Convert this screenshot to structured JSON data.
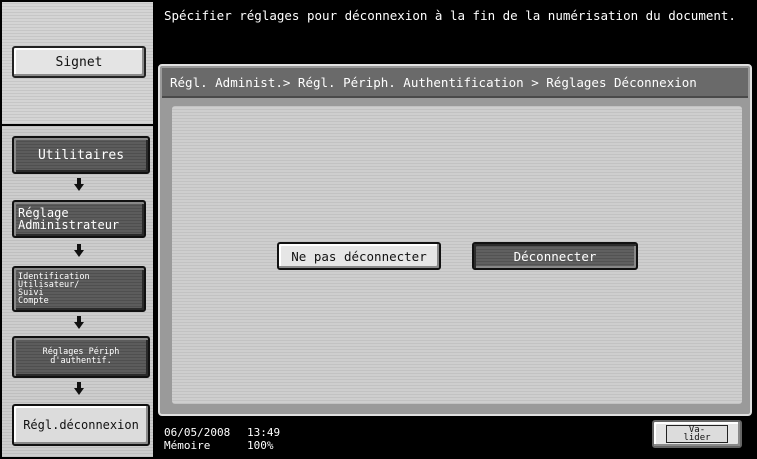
{
  "header": {
    "message": "Spécifier réglages pour déconnexion à la fin de la numérisation du document."
  },
  "sidebar": {
    "signet_label": "Signet",
    "flow": [
      {
        "label": "Utilitaires"
      },
      {
        "label_line1": "Réglage",
        "label_line2": "Administrateur"
      },
      {
        "label_line1": "Identification",
        "label_line2": "Utilisateur/",
        "label_line3": "Suivi",
        "label_line4": "Compte"
      },
      {
        "label_line1": "Réglages Périph",
        "label_line2": "d'authentif."
      },
      {
        "label": "Régl.déconnexion"
      }
    ]
  },
  "panel": {
    "breadcrumb": "Régl. Administ.> Régl. Périph. Authentification > Réglages Déconnexion",
    "options": [
      {
        "label": "Ne pas déconnecter",
        "selected": false
      },
      {
        "label": "Déconnecter",
        "selected": true
      }
    ]
  },
  "status": {
    "date": "06/05/2008",
    "time": "13:49",
    "memory_label": "Mémoire",
    "memory_value": "100%"
  },
  "footer": {
    "validate_line1": "Va-",
    "validate_line2": "lider"
  },
  "colors": {
    "background": "#000000",
    "panel": "#9a9a9a",
    "selected_button": "#5a5a5a"
  }
}
